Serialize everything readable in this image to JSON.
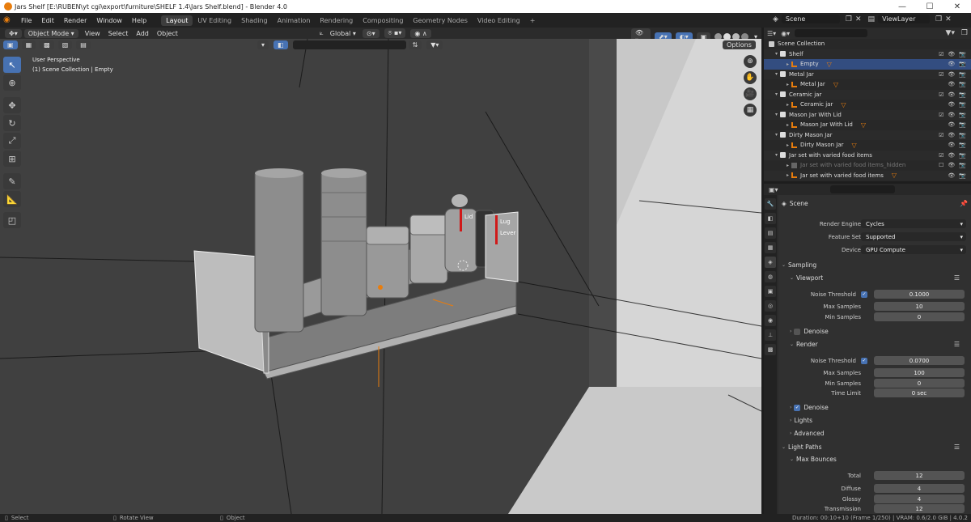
{
  "window": {
    "title": "Jars Shelf [E:\\RUBEN\\yt cgi\\export\\furniture\\SHELF 1.4\\Jars Shelf.blend] - Blender 4.0",
    "minimize": "—",
    "maximize": "☐",
    "close": "✕"
  },
  "menu": [
    "File",
    "Edit",
    "Render",
    "Window",
    "Help"
  ],
  "workspaces": [
    "Layout",
    "UV Editing",
    "Shading",
    "Animation",
    "Rendering",
    "Compositing",
    "Geometry Nodes",
    "Video Editing"
  ],
  "active_workspace": "Layout",
  "add_workspace": "+",
  "scene_name": "Scene",
  "view_layer": "ViewLayer",
  "viewport_header": {
    "mode": "Object Mode",
    "menus": [
      "View",
      "Select",
      "Add",
      "Object"
    ],
    "transform": "Global",
    "options": "Options"
  },
  "viewport_overlay": {
    "perspective": "User Perspective",
    "collection_info": "(1) Scene Collection | Empty"
  },
  "scene_labels": [
    "Lid",
    "Lug",
    "Lever"
  ],
  "outliner": {
    "root": "Scene Collection",
    "rows": [
      {
        "level": 0,
        "label": "Shelf",
        "type": "collection",
        "selected": false
      },
      {
        "level": 1,
        "label": "Empty",
        "type": "empty",
        "selected": true
      },
      {
        "level": 0,
        "label": "Metal Jar",
        "type": "collection",
        "selected": false
      },
      {
        "level": 1,
        "label": "Metal Jar",
        "type": "empty",
        "selected": false
      },
      {
        "level": 0,
        "label": "Ceramic jar",
        "type": "collection",
        "selected": false
      },
      {
        "level": 1,
        "label": "Ceramic jar",
        "type": "empty",
        "selected": false
      },
      {
        "level": 0,
        "label": "Mason Jar With Lid",
        "type": "collection",
        "selected": false
      },
      {
        "level": 1,
        "label": "Mason Jar With Lid",
        "type": "empty",
        "selected": false
      },
      {
        "level": 0,
        "label": "Dirty Mason Jar",
        "type": "collection",
        "selected": false
      },
      {
        "level": 1,
        "label": "Dirty Mason Jar",
        "type": "empty",
        "selected": false
      },
      {
        "level": 0,
        "label": "Jar set with varied food items",
        "type": "collection",
        "selected": false
      },
      {
        "level": 1,
        "label": "Jar set with varied food items_hidden",
        "type": "hidden",
        "selected": false
      },
      {
        "level": 1,
        "label": "Jar set with varied food items",
        "type": "empty",
        "selected": false
      }
    ]
  },
  "properties": {
    "context": "Scene",
    "render_engine_label": "Render Engine",
    "render_engine": "Cycles",
    "feature_set_label": "Feature Set",
    "feature_set": "Supported",
    "device_label": "Device",
    "device": "GPU Compute",
    "sampling": "Sampling",
    "viewport": "Viewport",
    "noise_threshold_label": "Noise Threshold",
    "viewport_noise_threshold": "0.1000",
    "max_samples_label": "Max Samples",
    "viewport_max_samples": "10",
    "min_samples_label": "Min Samples",
    "viewport_min_samples": "0",
    "denoise": "Denoise",
    "render": "Render",
    "render_noise_threshold": "0.0700",
    "render_max_samples": "100",
    "render_min_samples": "0",
    "time_limit_label": "Time Limit",
    "time_limit": "0 sec",
    "lights": "Lights",
    "advanced": "Advanced",
    "light_paths": "Light Paths",
    "max_bounces": "Max Bounces",
    "total_label": "Total",
    "total": "12",
    "diffuse_label": "Diffuse",
    "diffuse": "4",
    "glossy_label": "Glossy",
    "glossy": "4",
    "transmission_label": "Transmission",
    "transmission": "12"
  },
  "statusbar": {
    "select": "Select",
    "rotate": "Rotate View",
    "object": "Object",
    "info": "Duration: 00:10+10 (Frame 1/250) | VRAM: 0.6/2.0 GiB | 4.0.2"
  },
  "colors": {
    "accent": "#4772b3",
    "selected_row": "#334d80",
    "orange": "#e87d0d"
  }
}
